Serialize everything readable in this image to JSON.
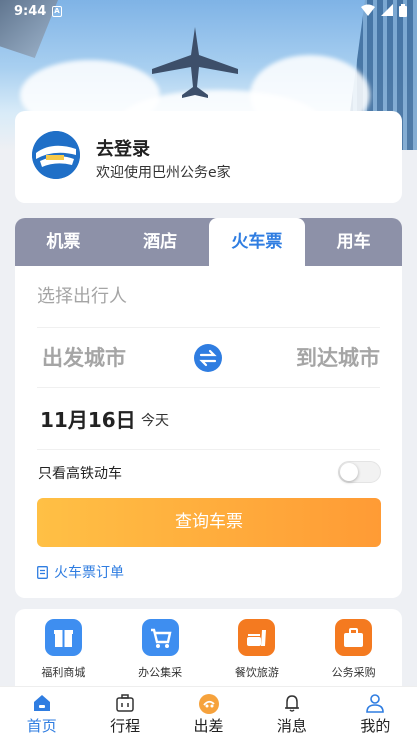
{
  "status_bar": {
    "time": "9:44",
    "app_icon_letter": "A"
  },
  "login": {
    "title": "去登录",
    "subtitle": "欢迎使用巴州公务e家"
  },
  "booking": {
    "tabs": [
      {
        "label": "机票",
        "active": false
      },
      {
        "label": "酒店",
        "active": false
      },
      {
        "label": "火车票",
        "active": true
      },
      {
        "label": "用车",
        "active": false
      }
    ],
    "traveler_placeholder": "选择出行人",
    "from_city": "出发城市",
    "to_city": "到达城市",
    "date": "11月16日",
    "date_hint": "今天",
    "high_speed_only_label": "只看高铁动车",
    "high_speed_only_on": false,
    "query_button": "查询车票",
    "orders_link": "火车票订单"
  },
  "services": [
    {
      "label": "福利商城",
      "icon": "gift-icon",
      "color": "#3e8ef0"
    },
    {
      "label": "办公集采",
      "icon": "cart-icon",
      "color": "#3e8ef0"
    },
    {
      "label": "餐饮旅游",
      "icon": "food-icon",
      "color": "#f47a20"
    },
    {
      "label": "公务采购",
      "icon": "briefcase-icon",
      "color": "#f47a20"
    }
  ],
  "nav": [
    {
      "label": "首页",
      "icon": "home-icon",
      "active": true
    },
    {
      "label": "行程",
      "icon": "suitcase-icon",
      "active": false
    },
    {
      "label": "出差",
      "icon": "travel-icon",
      "active": false
    },
    {
      "label": "消息",
      "icon": "bell-icon",
      "active": false
    },
    {
      "label": "我的",
      "icon": "user-icon",
      "active": false
    }
  ],
  "colors": {
    "accent": "#2f7de1",
    "tab_bar": "#8d91a8",
    "button_start": "#ffc045",
    "button_end": "#ff9b35"
  }
}
